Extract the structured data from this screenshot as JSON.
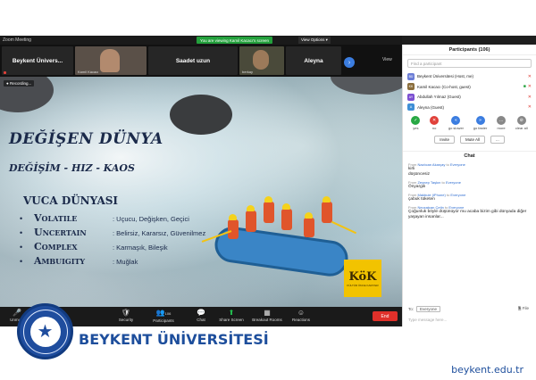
{
  "window": {
    "app_title": "Zoom Meeting",
    "banner": "You are viewing Kamil Kacacı's screen",
    "view_options": "View Options ▾"
  },
  "video_strip": {
    "tiles": [
      {
        "name": "Beykent Ünivers...",
        "caption": ""
      },
      {
        "name": "",
        "caption": "Kamil Kacacı"
      },
      {
        "name": "Saadet uzun",
        "caption": ""
      },
      {
        "name": "",
        "caption": "berkay"
      },
      {
        "name": "Aleyna",
        "caption": ""
      }
    ],
    "next": "›",
    "view_label": "View"
  },
  "slide": {
    "recording": "● Recording...",
    "title": "DEĞİŞEN DÜNYA",
    "subtitle": "DEĞİŞİM - HIZ - KAOS",
    "heading": "VUCA DÜNYASI",
    "items": [
      {
        "term": "Volatile",
        "def": ": Uçucu, Değişken, Geçici"
      },
      {
        "term": "Uncertain",
        "def": ": Belirsiz, Kararsız, Güvenilmez"
      },
      {
        "term": "Complex",
        "def": ": Karmaşık, Bileşik"
      },
      {
        "term": "Ambuigity",
        "def": ": Muğlak"
      }
    ],
    "logo_big": "KöK",
    "logo_small": "KÜLTÜR ÖNCE KARIYER"
  },
  "toolbar": {
    "buttons": [
      {
        "icon": "🎤",
        "label": "Unmute"
      },
      {
        "icon": "🛡",
        "label": "Security"
      },
      {
        "icon": "👥",
        "label": "Participants",
        "count": "106"
      },
      {
        "icon": "💬",
        "label": "Chat"
      },
      {
        "icon": "⬆",
        "label": "Share Screen"
      },
      {
        "icon": "▦",
        "label": "Breakout Rooms"
      },
      {
        "icon": "☺",
        "label": "Reactions"
      }
    ],
    "end": "End"
  },
  "participants": {
    "header": "Participants (106)",
    "search_placeholder": "Find a participant",
    "rows": [
      {
        "initials": "BÜ",
        "name": "Beykent Üniversitesi (Host, me)",
        "color": "#6b7dd6"
      },
      {
        "initials": "KK",
        "name": "Kamil Kacacı (Co-host, guest)",
        "color": "#8a6d3b"
      },
      {
        "initials": "AY",
        "name": "Abdullah Yılmaz (Guest)",
        "color": "#7b4fd1"
      },
      {
        "initials": "A",
        "name": "Aleyna (Guest)",
        "color": "#3f8fd6"
      },
      {
        "initials": "",
        "name": "",
        "color": "#cccccc"
      }
    ],
    "reactions": [
      {
        "label": "yes",
        "color": "#27a844",
        "glyph": "✓"
      },
      {
        "label": "no",
        "color": "#e0413a",
        "glyph": "✕"
      },
      {
        "label": "go slower",
        "color": "#3b7de0",
        "glyph": "«"
      },
      {
        "label": "go faster",
        "color": "#3b7de0",
        "glyph": "»"
      },
      {
        "label": "more",
        "color": "#888888",
        "glyph": "…"
      },
      {
        "label": "clear all",
        "color": "#888888",
        "glyph": "⊘"
      }
    ],
    "invite": "Invite",
    "mute_all": "Mute All",
    "more": "..."
  },
  "chat": {
    "header": "Chat",
    "messages": [
      {
        "from": "Nazlıcan Akarçay",
        "to": "Everyone",
        "text": "kirli\ndüşüncesiz"
      },
      {
        "from": "Zeynep Taşkın",
        "to": "Everyone",
        "text": "Önyargılı"
      },
      {
        "from": "Makbule (iPhone)",
        "to": "Everyone",
        "text": "çabuk tüketen"
      },
      {
        "from": "Nevzatcan Çetin",
        "to": "Everyone",
        "text": "Çoğunluk böyle düşünüyor mu acaba bizim gibi dünyada diğer yaşayan insanlar..."
      }
    ],
    "from_prefix": "From",
    "to_prefix": "to",
    "to_label": "To:",
    "to_value": "Everyone",
    "file": "File",
    "input_placeholder": "Type message here..."
  },
  "footer": {
    "brand": "BEYKENT ÜNİVERSİTESİ",
    "url": "beykent.edu.tr",
    "seal_text": "BEYKENT ÜNİVERSİTESİ İSTANBUL 1997"
  }
}
